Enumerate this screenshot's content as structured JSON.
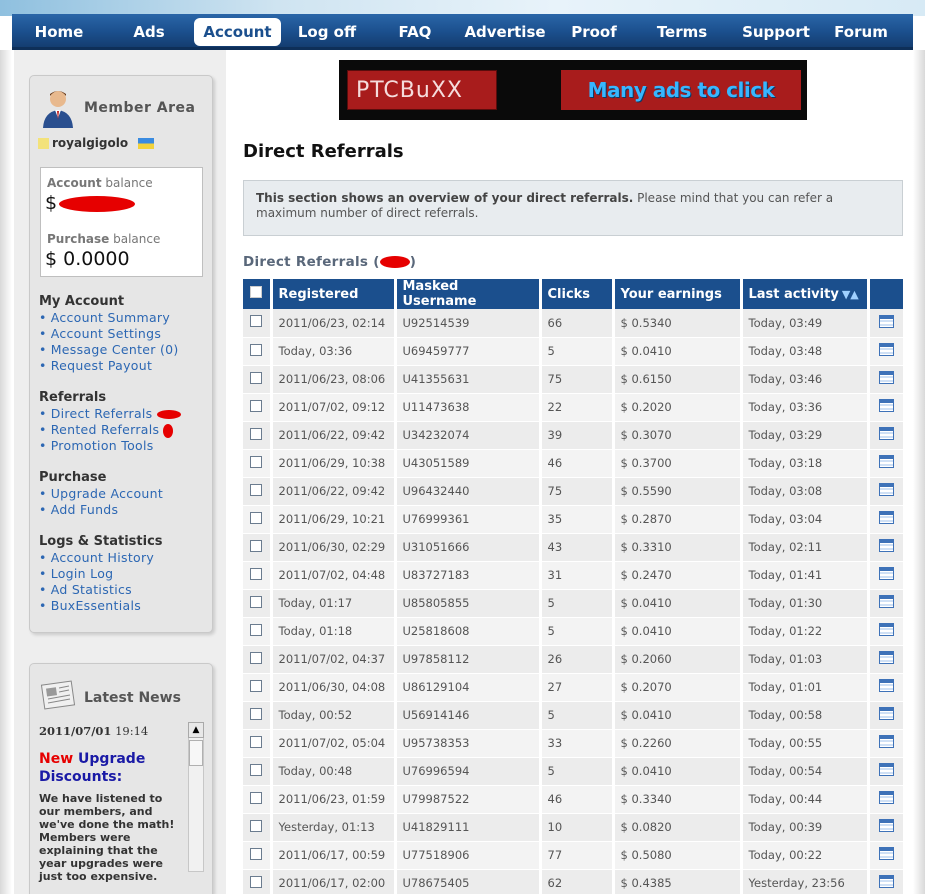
{
  "nav": [
    "Home",
    "Ads",
    "Account",
    "Log off",
    "FAQ",
    "Advertise",
    "Proof",
    "Terms",
    "Support",
    "Forum"
  ],
  "nav_active": "Account",
  "sidebar": {
    "member_title": "Member Area",
    "username": "royalgigolo",
    "account_balance_label_bold": "Account",
    "account_balance_label": " balance",
    "account_balance_currency": "$",
    "purchase_balance_label_bold": "Purchase",
    "purchase_balance_label": " balance",
    "purchase_balance_value": "$ 0.0000",
    "sections": [
      {
        "title": "My Account",
        "links": [
          "Account Summary",
          "Account Settings",
          "Message Center (0)",
          "Request Payout"
        ]
      },
      {
        "title": "Referrals",
        "links": [
          "Direct Referrals",
          "Rented Referrals",
          "Promotion Tools"
        ]
      },
      {
        "title": "Purchase",
        "links": [
          "Upgrade Account",
          "Add Funds"
        ]
      },
      {
        "title": "Logs & Statistics",
        "links": [
          "Account History",
          "Login Log",
          "Ad Statistics",
          "BuxEssentials"
        ]
      }
    ]
  },
  "news": {
    "title": "Latest News",
    "date": "2011/07/01",
    "time": " 19:14",
    "headline_red": "New",
    "headline_blue": " Upgrade Discounts:",
    "body": "We have listened to our members, and we've done the math! Members were explaining that the year upgrades were just too expensive."
  },
  "banner": {
    "left_text": "PTCBuXX",
    "right_text": "Many ads to click"
  },
  "main": {
    "title": "Direct Referrals",
    "info_bold": "This section shows an overview of your direct referrals.",
    "info_rest": " Please mind that you can refer a maximum number of direct referrals.",
    "subtitle": "Direct Referrals"
  },
  "table": {
    "headers": [
      "Registered",
      "Masked Username",
      "Clicks",
      "Your earnings",
      "Last activity"
    ],
    "rows": [
      [
        "2011/06/23, 02:14",
        "U92514539",
        "66",
        "$ 0.5340",
        "Today, 03:49"
      ],
      [
        "Today, 03:36",
        "U69459777",
        "5",
        "$ 0.0410",
        "Today, 03:48"
      ],
      [
        "2011/06/23, 08:06",
        "U41355631",
        "75",
        "$ 0.6150",
        "Today, 03:46"
      ],
      [
        "2011/07/02, 09:12",
        "U11473638",
        "22",
        "$ 0.2020",
        "Today, 03:36"
      ],
      [
        "2011/06/22, 09:42",
        "U34232074",
        "39",
        "$ 0.3070",
        "Today, 03:29"
      ],
      [
        "2011/06/29, 10:38",
        "U43051589",
        "46",
        "$ 0.3700",
        "Today, 03:18"
      ],
      [
        "2011/06/22, 09:42",
        "U96432440",
        "75",
        "$ 0.5590",
        "Today, 03:08"
      ],
      [
        "2011/06/29, 10:21",
        "U76999361",
        "35",
        "$ 0.2870",
        "Today, 03:04"
      ],
      [
        "2011/06/30, 02:29",
        "U31051666",
        "43",
        "$ 0.3310",
        "Today, 02:11"
      ],
      [
        "2011/07/02, 04:48",
        "U83727183",
        "31",
        "$ 0.2470",
        "Today, 01:41"
      ],
      [
        "Today, 01:17",
        "U85805855",
        "5",
        "$ 0.0410",
        "Today, 01:30"
      ],
      [
        "Today, 01:18",
        "U25818608",
        "5",
        "$ 0.0410",
        "Today, 01:22"
      ],
      [
        "2011/07/02, 04:37",
        "U97858112",
        "26",
        "$ 0.2060",
        "Today, 01:03"
      ],
      [
        "2011/06/30, 04:08",
        "U86129104",
        "27",
        "$ 0.2070",
        "Today, 01:01"
      ],
      [
        "Today, 00:52",
        "U56914146",
        "5",
        "$ 0.0410",
        "Today, 00:58"
      ],
      [
        "2011/07/02, 05:04",
        "U95738353",
        "33",
        "$ 0.2260",
        "Today, 00:55"
      ],
      [
        "Today, 00:48",
        "U76996594",
        "5",
        "$ 0.0410",
        "Today, 00:54"
      ],
      [
        "2011/06/23, 01:59",
        "U79987522",
        "46",
        "$ 0.3340",
        "Today, 00:44"
      ],
      [
        "Yesterday, 01:13",
        "U41829111",
        "10",
        "$ 0.0820",
        "Today, 00:39"
      ],
      [
        "2011/06/17, 00:59",
        "U77518906",
        "77",
        "$ 0.5080",
        "Today, 00:22"
      ],
      [
        "2011/06/17, 02:00",
        "U78675405",
        "62",
        "$ 0.4385",
        "Yesterday, 23:56"
      ]
    ]
  },
  "colors": {
    "nav_blue": "#1b4f8d",
    "link_blue": "#2c67b3",
    "redaction": "#e60000"
  }
}
